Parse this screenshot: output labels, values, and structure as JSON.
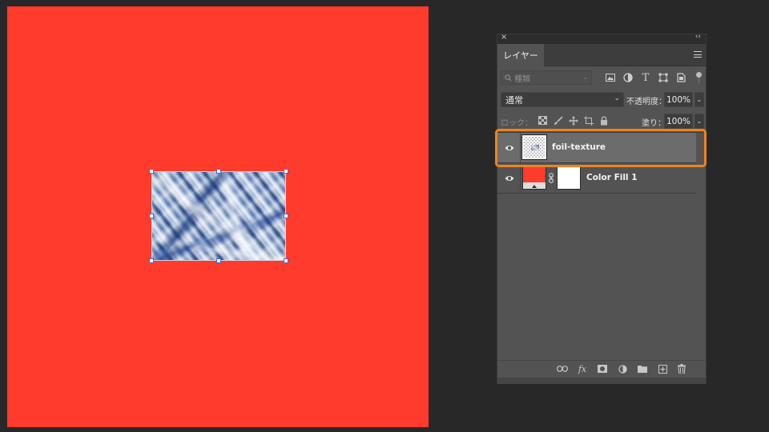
{
  "canvas": {
    "background_color": "#ff3b2b",
    "selected_layer_content": "foil texture image with transform handles"
  },
  "layers_panel": {
    "close_glyph": "×",
    "collapse_glyph": "‹‹",
    "tab_label": "レイヤー",
    "menu_icon": "panel-menu-icon",
    "filter": {
      "search_icon": "search-icon",
      "kind_placeholder": "種類",
      "chevron": "⌄",
      "type_icons": [
        "image-filter-icon",
        "adjustment-filter-icon",
        "type-filter-icon",
        "shape-filter-icon",
        "smart-object-filter-icon"
      ]
    },
    "blend_mode": "通常",
    "blend_chevron": "⌄",
    "opacity_label": "不透明度：",
    "opacity_value": "100%",
    "lock_label": "ロック：",
    "lock_icons": [
      "lock-transparent-pixels-icon",
      "lock-image-pixels-icon",
      "lock-position-icon",
      "lock-artboard-icon",
      "lock-all-icon"
    ],
    "fill_label": "塗り：",
    "fill_value": "100%",
    "dropdown_chevron": "⌄",
    "layers": [
      {
        "name": "foil-texture",
        "visible": true,
        "selected": true,
        "thumb": "transparent-with-image"
      },
      {
        "name": "Color Fill 1",
        "visible": true,
        "selected": false,
        "thumb": "color-fill",
        "fill_color": "#ff3b2b",
        "mask": "white"
      }
    ],
    "bottom_icons": [
      "link-layers-icon",
      "fx-icon",
      "add-mask-icon",
      "adjustment-layer-icon",
      "new-group-icon",
      "new-layer-icon",
      "delete-icon"
    ],
    "fx_text": "fx",
    "highlight_color": "#f0821e"
  }
}
